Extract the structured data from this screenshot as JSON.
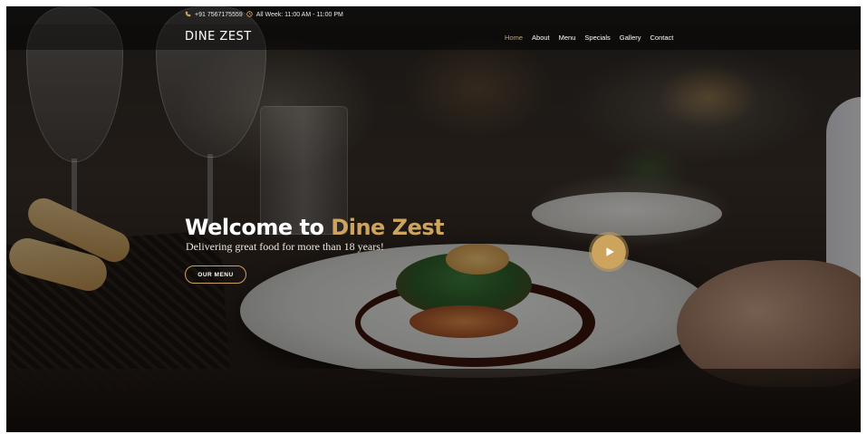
{
  "topbar": {
    "phone_icon": "phone-icon",
    "phone": "+91 7567175559",
    "clock_icon": "clock-icon",
    "hours": "All Week: 11:00 AM - 11:00 PM"
  },
  "header": {
    "logo": "DINE ZEST",
    "nav": [
      {
        "label": "Home",
        "active": true
      },
      {
        "label": "About"
      },
      {
        "label": "Menu"
      },
      {
        "label": "Specials"
      },
      {
        "label": "Gallery"
      },
      {
        "label": "Contact"
      }
    ]
  },
  "hero": {
    "title_prefix": "Welcome to",
    "title_accent": "Dine Zest",
    "subtitle": "Delivering great food for more than 18 years!",
    "cta_label": "OUR MENU",
    "play_icon": "play-icon"
  },
  "colors": {
    "accent": "#cda45e",
    "text": "#ffffff"
  }
}
